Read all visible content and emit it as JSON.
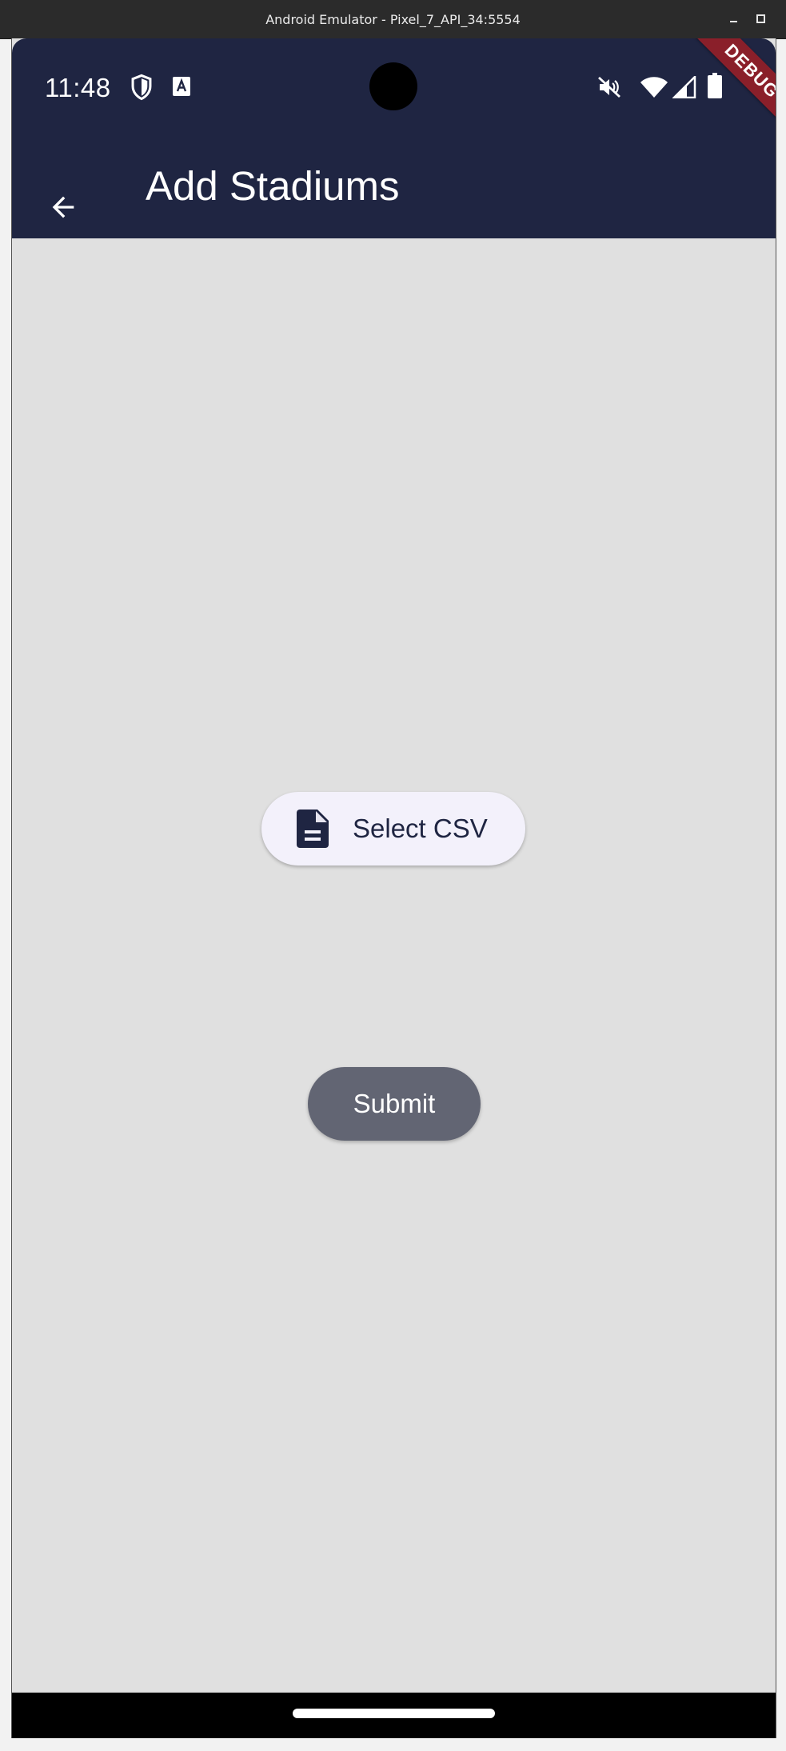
{
  "window": {
    "title": "Android Emulator - Pixel_7_API_34:5554"
  },
  "status_bar": {
    "time": "11:48",
    "icons": [
      "shield-icon",
      "text-a-icon",
      "mute-icon",
      "wifi-icon",
      "signal-icon",
      "battery-icon"
    ]
  },
  "debug_banner": "DEBUG",
  "app_bar": {
    "title": "Add Stadiums",
    "back_icon": "arrow-back-icon",
    "background": "#1f2542"
  },
  "main": {
    "select_csv_label": "Select CSV",
    "select_csv_icon": "file-document-icon",
    "submit_label": "Submit"
  },
  "colors": {
    "primary": "#1f2542",
    "content_bg": "#e0e0e0",
    "submit_bg": "#626573",
    "select_bg": "#f3f1fb",
    "debug_ribbon": "#8a1f2a"
  }
}
